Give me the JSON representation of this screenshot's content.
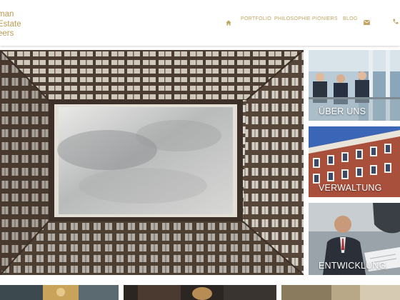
{
  "logo": {
    "lines": [
      "man",
      "Estate",
      "eers"
    ]
  },
  "nav": {
    "items": [
      {
        "label": "PORTFOLIO"
      },
      {
        "label": "PHILOSOPHIE"
      },
      {
        "label": "PIONIERS"
      },
      {
        "label": "BLOG"
      }
    ],
    "icons": [
      "home-icon",
      "envelope-icon",
      "phone-icon"
    ],
    "accent_color": "#c1a35f"
  },
  "tiles": [
    {
      "label": "ÜBER UNS"
    },
    {
      "label": "VERWALTUNG"
    },
    {
      "label": "ENTWICKLUNG"
    }
  ]
}
